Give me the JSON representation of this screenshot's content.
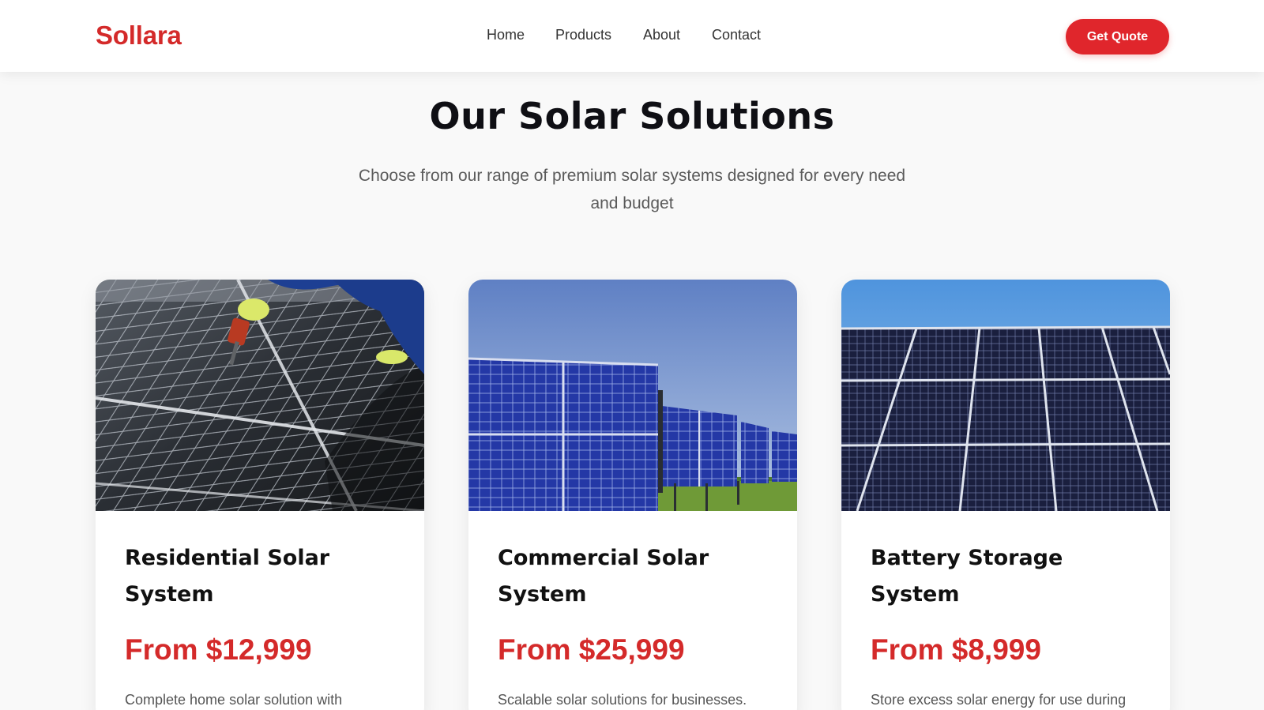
{
  "brand": {
    "name": "Sollara",
    "accent": "#d42a2a",
    "cta_color": "#e0262c"
  },
  "nav": {
    "items": [
      "Home",
      "Products",
      "About",
      "Contact"
    ],
    "cta_label": "Get Quote"
  },
  "hero": {
    "title": "Our Solar Solutions",
    "subtitle": "Choose from our range of premium solar systems designed for every need and budget"
  },
  "products": [
    {
      "title": "Residential Solar System",
      "price": "From $12,999",
      "description": "Complete home solar solution with",
      "image": "rooftop-solar-panels-installation-photo"
    },
    {
      "title": "Commercial Solar System",
      "price": "From $25,999",
      "description": "Scalable solar solutions for businesses.",
      "image": "solar-farm-panels-on-grass-photo"
    },
    {
      "title": "Battery Storage System",
      "price": "From $8,999",
      "description": "Store excess solar energy for use during",
      "image": "solar-panel-array-blue-sky-photo"
    }
  ]
}
